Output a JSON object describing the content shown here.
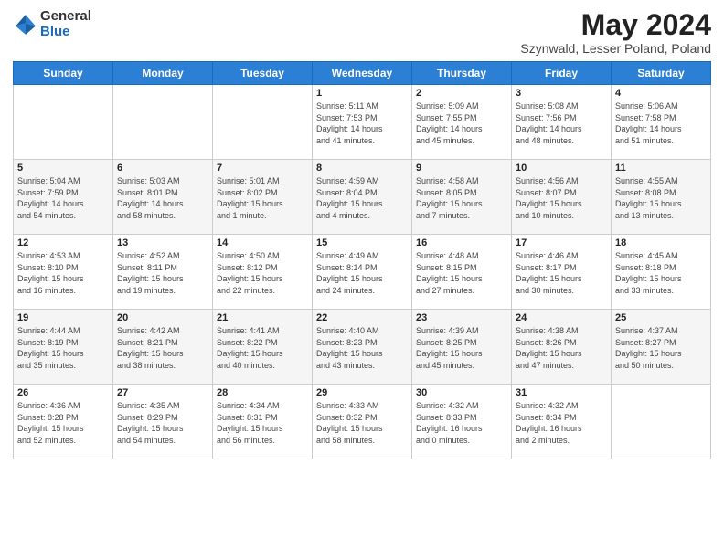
{
  "header": {
    "logo_general": "General",
    "logo_blue": "Blue",
    "title": "May 2024",
    "subtitle": "Szynwald, Lesser Poland, Poland"
  },
  "weekdays": [
    "Sunday",
    "Monday",
    "Tuesday",
    "Wednesday",
    "Thursday",
    "Friday",
    "Saturday"
  ],
  "weeks": [
    [
      {
        "day": "",
        "info": ""
      },
      {
        "day": "",
        "info": ""
      },
      {
        "day": "",
        "info": ""
      },
      {
        "day": "1",
        "info": "Sunrise: 5:11 AM\nSunset: 7:53 PM\nDaylight: 14 hours\nand 41 minutes."
      },
      {
        "day": "2",
        "info": "Sunrise: 5:09 AM\nSunset: 7:55 PM\nDaylight: 14 hours\nand 45 minutes."
      },
      {
        "day": "3",
        "info": "Sunrise: 5:08 AM\nSunset: 7:56 PM\nDaylight: 14 hours\nand 48 minutes."
      },
      {
        "day": "4",
        "info": "Sunrise: 5:06 AM\nSunset: 7:58 PM\nDaylight: 14 hours\nand 51 minutes."
      }
    ],
    [
      {
        "day": "5",
        "info": "Sunrise: 5:04 AM\nSunset: 7:59 PM\nDaylight: 14 hours\nand 54 minutes."
      },
      {
        "day": "6",
        "info": "Sunrise: 5:03 AM\nSunset: 8:01 PM\nDaylight: 14 hours\nand 58 minutes."
      },
      {
        "day": "7",
        "info": "Sunrise: 5:01 AM\nSunset: 8:02 PM\nDaylight: 15 hours\nand 1 minute."
      },
      {
        "day": "8",
        "info": "Sunrise: 4:59 AM\nSunset: 8:04 PM\nDaylight: 15 hours\nand 4 minutes."
      },
      {
        "day": "9",
        "info": "Sunrise: 4:58 AM\nSunset: 8:05 PM\nDaylight: 15 hours\nand 7 minutes."
      },
      {
        "day": "10",
        "info": "Sunrise: 4:56 AM\nSunset: 8:07 PM\nDaylight: 15 hours\nand 10 minutes."
      },
      {
        "day": "11",
        "info": "Sunrise: 4:55 AM\nSunset: 8:08 PM\nDaylight: 15 hours\nand 13 minutes."
      }
    ],
    [
      {
        "day": "12",
        "info": "Sunrise: 4:53 AM\nSunset: 8:10 PM\nDaylight: 15 hours\nand 16 minutes."
      },
      {
        "day": "13",
        "info": "Sunrise: 4:52 AM\nSunset: 8:11 PM\nDaylight: 15 hours\nand 19 minutes."
      },
      {
        "day": "14",
        "info": "Sunrise: 4:50 AM\nSunset: 8:12 PM\nDaylight: 15 hours\nand 22 minutes."
      },
      {
        "day": "15",
        "info": "Sunrise: 4:49 AM\nSunset: 8:14 PM\nDaylight: 15 hours\nand 24 minutes."
      },
      {
        "day": "16",
        "info": "Sunrise: 4:48 AM\nSunset: 8:15 PM\nDaylight: 15 hours\nand 27 minutes."
      },
      {
        "day": "17",
        "info": "Sunrise: 4:46 AM\nSunset: 8:17 PM\nDaylight: 15 hours\nand 30 minutes."
      },
      {
        "day": "18",
        "info": "Sunrise: 4:45 AM\nSunset: 8:18 PM\nDaylight: 15 hours\nand 33 minutes."
      }
    ],
    [
      {
        "day": "19",
        "info": "Sunrise: 4:44 AM\nSunset: 8:19 PM\nDaylight: 15 hours\nand 35 minutes."
      },
      {
        "day": "20",
        "info": "Sunrise: 4:42 AM\nSunset: 8:21 PM\nDaylight: 15 hours\nand 38 minutes."
      },
      {
        "day": "21",
        "info": "Sunrise: 4:41 AM\nSunset: 8:22 PM\nDaylight: 15 hours\nand 40 minutes."
      },
      {
        "day": "22",
        "info": "Sunrise: 4:40 AM\nSunset: 8:23 PM\nDaylight: 15 hours\nand 43 minutes."
      },
      {
        "day": "23",
        "info": "Sunrise: 4:39 AM\nSunset: 8:25 PM\nDaylight: 15 hours\nand 45 minutes."
      },
      {
        "day": "24",
        "info": "Sunrise: 4:38 AM\nSunset: 8:26 PM\nDaylight: 15 hours\nand 47 minutes."
      },
      {
        "day": "25",
        "info": "Sunrise: 4:37 AM\nSunset: 8:27 PM\nDaylight: 15 hours\nand 50 minutes."
      }
    ],
    [
      {
        "day": "26",
        "info": "Sunrise: 4:36 AM\nSunset: 8:28 PM\nDaylight: 15 hours\nand 52 minutes."
      },
      {
        "day": "27",
        "info": "Sunrise: 4:35 AM\nSunset: 8:29 PM\nDaylight: 15 hours\nand 54 minutes."
      },
      {
        "day": "28",
        "info": "Sunrise: 4:34 AM\nSunset: 8:31 PM\nDaylight: 15 hours\nand 56 minutes."
      },
      {
        "day": "29",
        "info": "Sunrise: 4:33 AM\nSunset: 8:32 PM\nDaylight: 15 hours\nand 58 minutes."
      },
      {
        "day": "30",
        "info": "Sunrise: 4:32 AM\nSunset: 8:33 PM\nDaylight: 16 hours\nand 0 minutes."
      },
      {
        "day": "31",
        "info": "Sunrise: 4:32 AM\nSunset: 8:34 PM\nDaylight: 16 hours\nand 2 minutes."
      },
      {
        "day": "",
        "info": ""
      }
    ]
  ]
}
